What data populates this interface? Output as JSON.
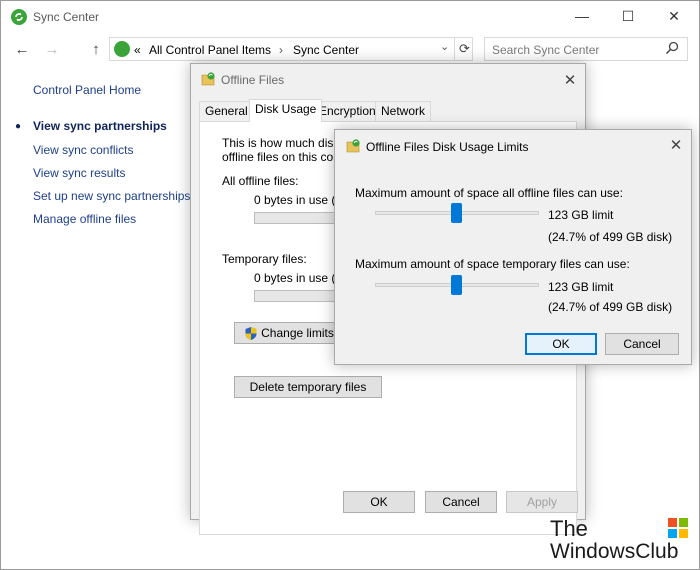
{
  "main_window": {
    "title": "Sync Center",
    "address": {
      "back_glyph": "←",
      "forward_glyph": "→",
      "up_glyph": "↑",
      "chevron": "«",
      "segments": [
        "All Control Panel Items",
        "Sync Center"
      ],
      "separator": "›"
    },
    "search": {
      "placeholder": "Search Sync Center"
    },
    "window_controls": {
      "minimize": "—",
      "maximize": "☐",
      "close": "✕"
    }
  },
  "sidebar": {
    "home": "Control Panel Home",
    "items": [
      {
        "label": "View sync partnerships",
        "current": true
      },
      {
        "label": "View sync conflicts"
      },
      {
        "label": "View sync results"
      },
      {
        "label": "Set up new sync partnerships"
      },
      {
        "label": "Manage offline files"
      }
    ]
  },
  "offline_files_dialog": {
    "title": "Offline Files",
    "tabs": [
      {
        "label": "General"
      },
      {
        "label": "Disk Usage",
        "active": true
      },
      {
        "label": "Encryption"
      },
      {
        "label": "Network"
      }
    ],
    "intro_line1": "This is how much disk sp",
    "intro_line2": "offline files on this comp",
    "all_label": "All offline files:",
    "all_usage": "0 bytes in use (1",
    "temp_label": "Temporary files:",
    "temp_usage": "0 bytes in use (1",
    "change_limits": "Change limits",
    "delete_temp": "Delete temporary files",
    "ok": "OK",
    "cancel": "Cancel",
    "apply": "Apply"
  },
  "limits_dialog": {
    "title": "Offline Files Disk Usage Limits",
    "all_label": "Maximum amount of space all offline files can use:",
    "all_limit": "123 GB limit",
    "all_percent": "(24.7% of 499 GB disk)",
    "all_slider_fraction": 0.247,
    "temp_label": "Maximum amount of space temporary files can use:",
    "temp_limit": "123 GB limit",
    "temp_percent": "(24.7% of 499 GB disk)",
    "temp_slider_fraction": 0.247,
    "ok": "OK",
    "cancel": "Cancel"
  },
  "watermark": {
    "line1": "The",
    "line2": "WindowsClub"
  },
  "colors": {
    "accent": "#0078d7",
    "link": "#1e3f8c",
    "sync_green": "#3aa33a"
  }
}
